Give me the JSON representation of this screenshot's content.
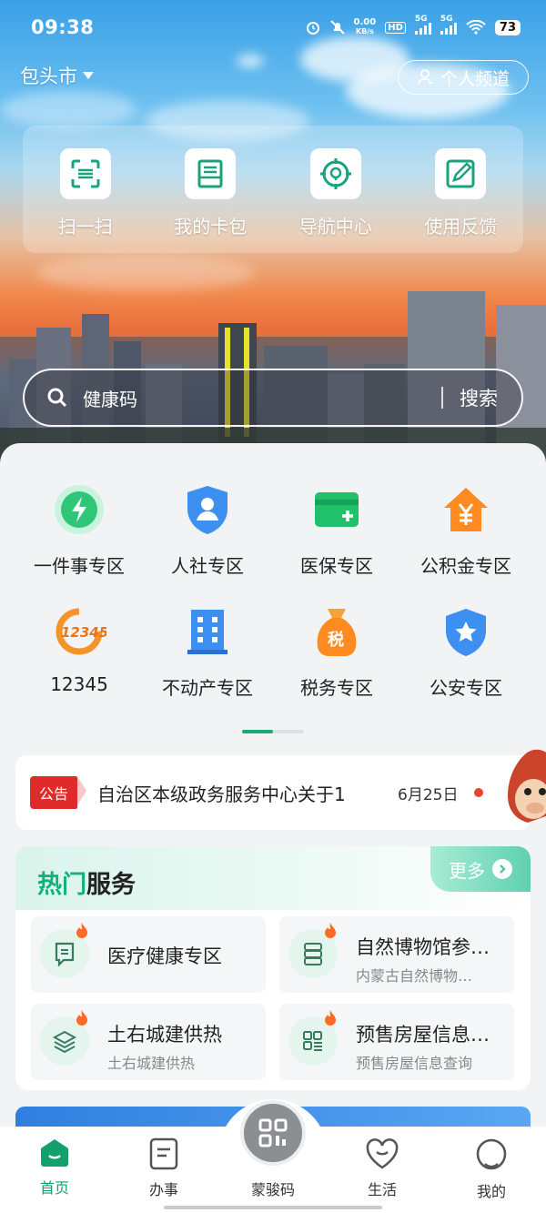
{
  "status_bar": {
    "time": "09:38",
    "net_speed_value": "0.00",
    "net_speed_unit": "KB/s",
    "hd_label": "HD",
    "signal_label_1": "5G",
    "signal_label_2": "5G",
    "battery": "73"
  },
  "header": {
    "city": "包头市",
    "channel_button": "个人频道"
  },
  "quick_actions": [
    {
      "label": "扫一扫",
      "icon": "scan-icon"
    },
    {
      "label": "我的卡包",
      "icon": "wallet-icon"
    },
    {
      "label": "导航中心",
      "icon": "location-icon"
    },
    {
      "label": "使用反馈",
      "icon": "feedback-icon"
    }
  ],
  "search": {
    "placeholder": "健康码",
    "button": "搜索"
  },
  "service_grid": [
    {
      "label": "一件事专区",
      "icon": "lightning-icon"
    },
    {
      "label": "人社专区",
      "icon": "shield-person-icon"
    },
    {
      "label": "医保专区",
      "icon": "medical-card-icon"
    },
    {
      "label": "公积金专区",
      "icon": "house-yuan-icon"
    },
    {
      "label": "12345",
      "icon": "hotline-12345-icon",
      "logo_text": "12345"
    },
    {
      "label": "不动产专区",
      "icon": "building-icon"
    },
    {
      "label": "税务专区",
      "icon": "tax-bag-icon",
      "logo_text": "税"
    },
    {
      "label": "公安专区",
      "icon": "police-badge-icon"
    }
  ],
  "pager": {
    "current": 1,
    "total": 2
  },
  "notice": {
    "badge": "公告",
    "text": "自治区本级政务服务中心关于1",
    "date": "6月25日"
  },
  "hot_services": {
    "title_part1": "热门",
    "title_part2": "服务",
    "more": "更多",
    "items": [
      {
        "name": "医疗健康专区",
        "sub": "",
        "icon": "chat-doc-icon"
      },
      {
        "name": "自然博物馆参…",
        "sub": "内蒙古自然博物…",
        "icon": "server-icon"
      },
      {
        "name": "土右城建供热",
        "sub": "土右城建供热",
        "icon": "layers-icon"
      },
      {
        "name": "预售房屋信息…",
        "sub": "预售房屋信息查询",
        "icon": "grid-list-icon"
      }
    ]
  },
  "bottom_nav": [
    {
      "label": "首页",
      "icon": "home-icon",
      "active": true
    },
    {
      "label": "办事",
      "icon": "document-icon",
      "active": false
    },
    {
      "label": "蒙骏码",
      "icon": "qr-code-icon",
      "active": false
    },
    {
      "label": "生活",
      "icon": "heart-icon",
      "active": false
    },
    {
      "label": "我的",
      "icon": "user-face-icon",
      "active": false
    }
  ],
  "colors": {
    "accent": "#13b07a",
    "notice_red": "#e02b2b",
    "nav_active": "#13a06d"
  }
}
